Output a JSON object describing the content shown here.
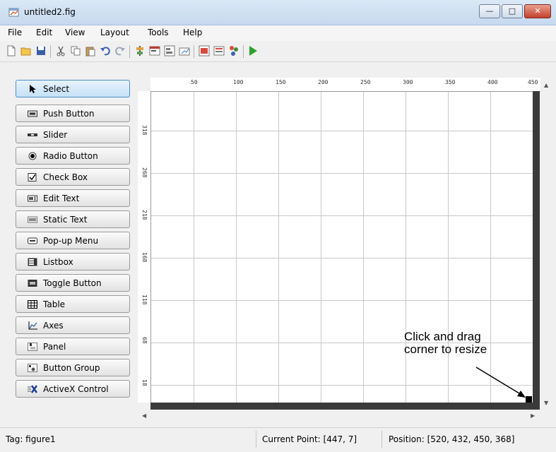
{
  "window": {
    "title": "untitled2.fig",
    "minimize": "—",
    "maximize": "□",
    "close": "✕"
  },
  "menu": [
    "File",
    "Edit",
    "View",
    "Layout",
    "Tools",
    "Help"
  ],
  "toolbar": {
    "icons": [
      "new-file-icon",
      "open-folder-icon",
      "save-icon",
      "cut-icon",
      "copy-icon",
      "paste-icon",
      "undo-icon",
      "redo-icon",
      "align-objects-icon",
      "menu-editor-icon",
      "tab-order-icon",
      "toolbar-editor-icon",
      "editor-icon",
      "property-inspector-icon",
      "object-browser-icon",
      "run-icon"
    ]
  },
  "palette": [
    {
      "label": "Select",
      "icon": "arrow-cursor-icon"
    },
    {
      "label": "Push Button",
      "icon": "push-button-icon"
    },
    {
      "label": "Slider",
      "icon": "slider-icon"
    },
    {
      "label": "Radio Button",
      "icon": "radio-button-icon"
    },
    {
      "label": "Check Box",
      "icon": "check-box-icon"
    },
    {
      "label": "Edit Text",
      "icon": "edit-text-icon"
    },
    {
      "label": "Static Text",
      "icon": "static-text-icon"
    },
    {
      "label": "Pop-up Menu",
      "icon": "popup-menu-icon"
    },
    {
      "label": "Listbox",
      "icon": "listbox-icon"
    },
    {
      "label": "Toggle Button",
      "icon": "toggle-button-icon"
    },
    {
      "label": "Table",
      "icon": "table-icon"
    },
    {
      "label": "Axes",
      "icon": "axes-icon"
    },
    {
      "label": "Panel",
      "icon": "panel-icon"
    },
    {
      "label": "Button Group",
      "icon": "button-group-icon"
    },
    {
      "label": "ActiveX Control",
      "icon": "activex-icon"
    }
  ],
  "ruler": {
    "horizontal": [
      "50",
      "100",
      "150",
      "200",
      "250",
      "300",
      "350",
      "400",
      "450"
    ],
    "vertical": [
      "318",
      "268",
      "218",
      "168",
      "118",
      "68",
      "18"
    ]
  },
  "callout": {
    "line1": "Click and drag",
    "line2": "corner to resize"
  },
  "status": {
    "tag": "Tag: figure1",
    "current_point": "Current Point:  [447, 7]",
    "position": "Position: [520, 432, 450, 368]"
  },
  "colors": {
    "title_bar": "#c6d9ef",
    "selected_button": "#c5e1f7",
    "canvas_edge": "#3a3a3a",
    "run_green": "#2da12d"
  }
}
